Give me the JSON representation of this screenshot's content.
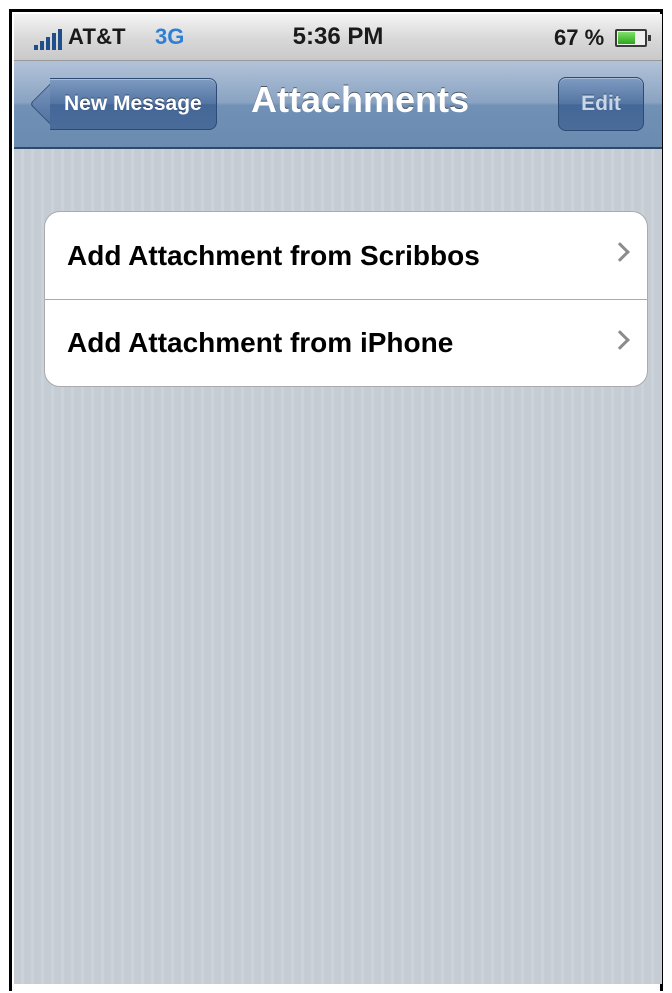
{
  "status_bar": {
    "carrier": "AT&T",
    "network": "3G",
    "time": "5:36 PM",
    "battery_percent": "67 %",
    "battery_level": 0.67,
    "signal_icon": "signal-bars-icon",
    "battery_icon": "battery-icon"
  },
  "nav_bar": {
    "back_label": "New Message",
    "title": "Attachments",
    "edit_label": "Edit"
  },
  "list": {
    "items": [
      {
        "label": "Add Attachment from Scribbos",
        "icon": "chevron-right-icon"
      },
      {
        "label": "Add Attachment from iPhone",
        "icon": "chevron-right-icon"
      }
    ]
  },
  "colors": {
    "nav_bar": "#6c8bb1",
    "network_blue": "#2f7fd6",
    "background": "#c5ccd4"
  }
}
